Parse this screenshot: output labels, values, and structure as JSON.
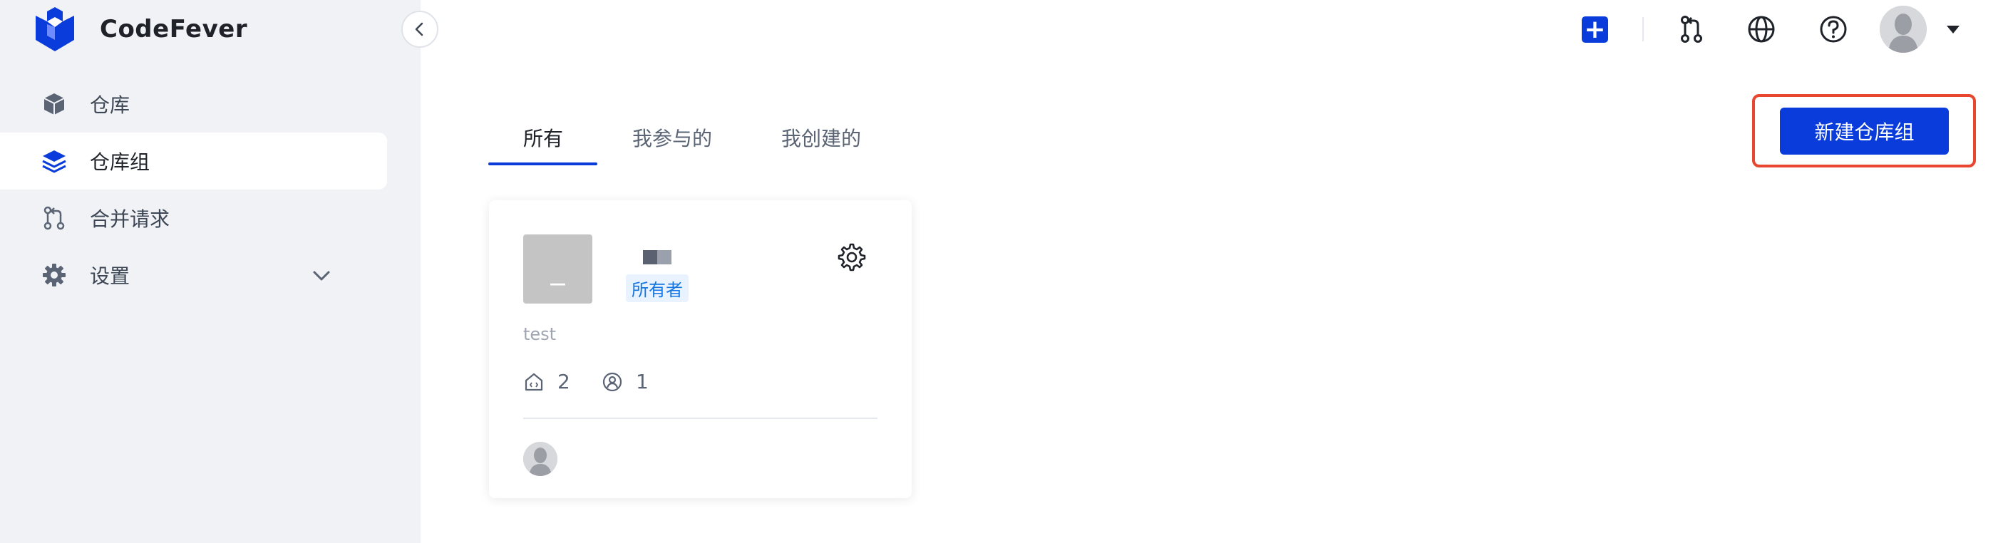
{
  "app": {
    "name": "CodeFever"
  },
  "sidebar": {
    "items": [
      {
        "label": "仓库",
        "icon": "cube-icon"
      },
      {
        "label": "仓库组",
        "icon": "layers-icon"
      },
      {
        "label": "合并请求",
        "icon": "merge-request-icon"
      },
      {
        "label": "设置",
        "icon": "gear-icon"
      }
    ]
  },
  "tabs": [
    {
      "label": "所有"
    },
    {
      "label": "我参与的"
    },
    {
      "label": "我创建的"
    }
  ],
  "new_group_button": "新建仓库组",
  "card": {
    "avatar_text": "_",
    "role_badge": "所有者",
    "description": "test",
    "repo_count": "2",
    "member_count": "1"
  },
  "colors": {
    "accent": "#0a3cdc",
    "highlight": "#e8462e",
    "sidebar_bg": "#f0f2f5"
  }
}
